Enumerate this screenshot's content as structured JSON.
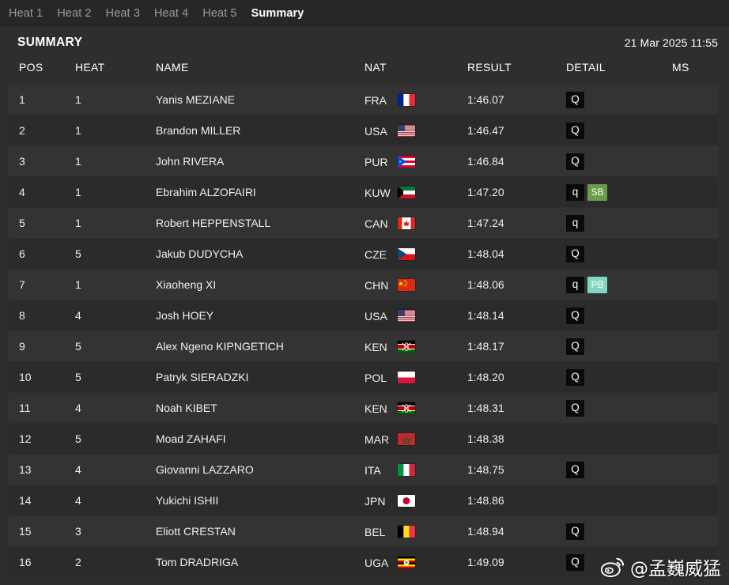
{
  "tabs": [
    {
      "label": "Heat 1",
      "active": false
    },
    {
      "label": "Heat 2",
      "active": false
    },
    {
      "label": "Heat 3",
      "active": false
    },
    {
      "label": "Heat 4",
      "active": false
    },
    {
      "label": "Heat 5",
      "active": false
    },
    {
      "label": "Summary",
      "active": true
    }
  ],
  "panel": {
    "title": "SUMMARY",
    "date": "21 Mar 2025 11:55"
  },
  "columns": {
    "pos": "POS",
    "heat": "HEAT",
    "name": "NAME",
    "nat": "NAT",
    "result": "RESULT",
    "detail": "DETAIL",
    "ms": "MS"
  },
  "colors": {
    "page_bg": "#272727",
    "panel_bg": "#2e2e2e",
    "row_odd": "#333333",
    "row_even": "#2b2b2b",
    "badge_q_bg": "#0a0a0a",
    "badge_sb_bg": "#6b9b4c",
    "badge_pb_bg": "#7fd6c1",
    "tab_inactive": "#9b9b9b",
    "tab_active": "#ffffff"
  },
  "rows": [
    {
      "pos": "1",
      "heat": "1",
      "name": "Yanis MEZIANE",
      "nat": "FRA",
      "flag": "flag-fra",
      "result": "1:46.07",
      "detail": [
        "Q"
      ],
      "ms": ""
    },
    {
      "pos": "2",
      "heat": "1",
      "name": "Brandon MILLER",
      "nat": "USA",
      "flag": "flag-usa",
      "result": "1:46.47",
      "detail": [
        "Q"
      ],
      "ms": ""
    },
    {
      "pos": "3",
      "heat": "1",
      "name": "John RIVERA",
      "nat": "PUR",
      "flag": "flag-pur",
      "result": "1:46.84",
      "detail": [
        "Q"
      ],
      "ms": ""
    },
    {
      "pos": "4",
      "heat": "1",
      "name": "Ebrahim ALZOFAIRI",
      "nat": "KUW",
      "flag": "flag-kuw",
      "result": "1:47.20",
      "detail": [
        "q",
        "SB"
      ],
      "ms": ""
    },
    {
      "pos": "5",
      "heat": "1",
      "name": "Robert HEPPENSTALL",
      "nat": "CAN",
      "flag": "flag-can",
      "result": "1:47.24",
      "detail": [
        "q"
      ],
      "ms": ""
    },
    {
      "pos": "6",
      "heat": "5",
      "name": "Jakub DUDYCHA",
      "nat": "CZE",
      "flag": "flag-cze",
      "result": "1:48.04",
      "detail": [
        "Q"
      ],
      "ms": ""
    },
    {
      "pos": "7",
      "heat": "1",
      "name": "Xiaoheng XI",
      "nat": "CHN",
      "flag": "flag-chn",
      "result": "1:48.06",
      "detail": [
        "q",
        "PB"
      ],
      "ms": ""
    },
    {
      "pos": "8",
      "heat": "4",
      "name": "Josh HOEY",
      "nat": "USA",
      "flag": "flag-usa",
      "result": "1:48.14",
      "detail": [
        "Q"
      ],
      "ms": ""
    },
    {
      "pos": "9",
      "heat": "5",
      "name": "Alex Ngeno KIPNGETICH",
      "nat": "KEN",
      "flag": "flag-ken",
      "result": "1:48.17",
      "detail": [
        "Q"
      ],
      "ms": ""
    },
    {
      "pos": "10",
      "heat": "5",
      "name": "Patryk SIERADZKI",
      "nat": "POL",
      "flag": "flag-pol",
      "result": "1:48.20",
      "detail": [
        "Q"
      ],
      "ms": ""
    },
    {
      "pos": "11",
      "heat": "4",
      "name": "Noah KIBET",
      "nat": "KEN",
      "flag": "flag-ken",
      "result": "1:48.31",
      "detail": [
        "Q"
      ],
      "ms": ""
    },
    {
      "pos": "12",
      "heat": "5",
      "name": "Moad ZAHAFI",
      "nat": "MAR",
      "flag": "flag-mar",
      "result": "1:48.38",
      "detail": [],
      "ms": ""
    },
    {
      "pos": "13",
      "heat": "4",
      "name": "Giovanni LAZZARO",
      "nat": "ITA",
      "flag": "flag-ita",
      "result": "1:48.75",
      "detail": [
        "Q"
      ],
      "ms": ""
    },
    {
      "pos": "14",
      "heat": "4",
      "name": "Yukichi ISHII",
      "nat": "JPN",
      "flag": "flag-jpn",
      "result": "1:48.86",
      "detail": [],
      "ms": ""
    },
    {
      "pos": "15",
      "heat": "3",
      "name": "Eliott CRESTAN",
      "nat": "BEL",
      "flag": "flag-bel",
      "result": "1:48.94",
      "detail": [
        "Q"
      ],
      "ms": ""
    },
    {
      "pos": "16",
      "heat": "2",
      "name": "Tom DRADRIGA",
      "nat": "UGA",
      "flag": "flag-uga",
      "result": "1:49.09",
      "detail": [
        "Q"
      ],
      "ms": ""
    }
  ],
  "watermark": {
    "icon": "weibo-logo-icon",
    "text": "@孟巍威猛"
  }
}
